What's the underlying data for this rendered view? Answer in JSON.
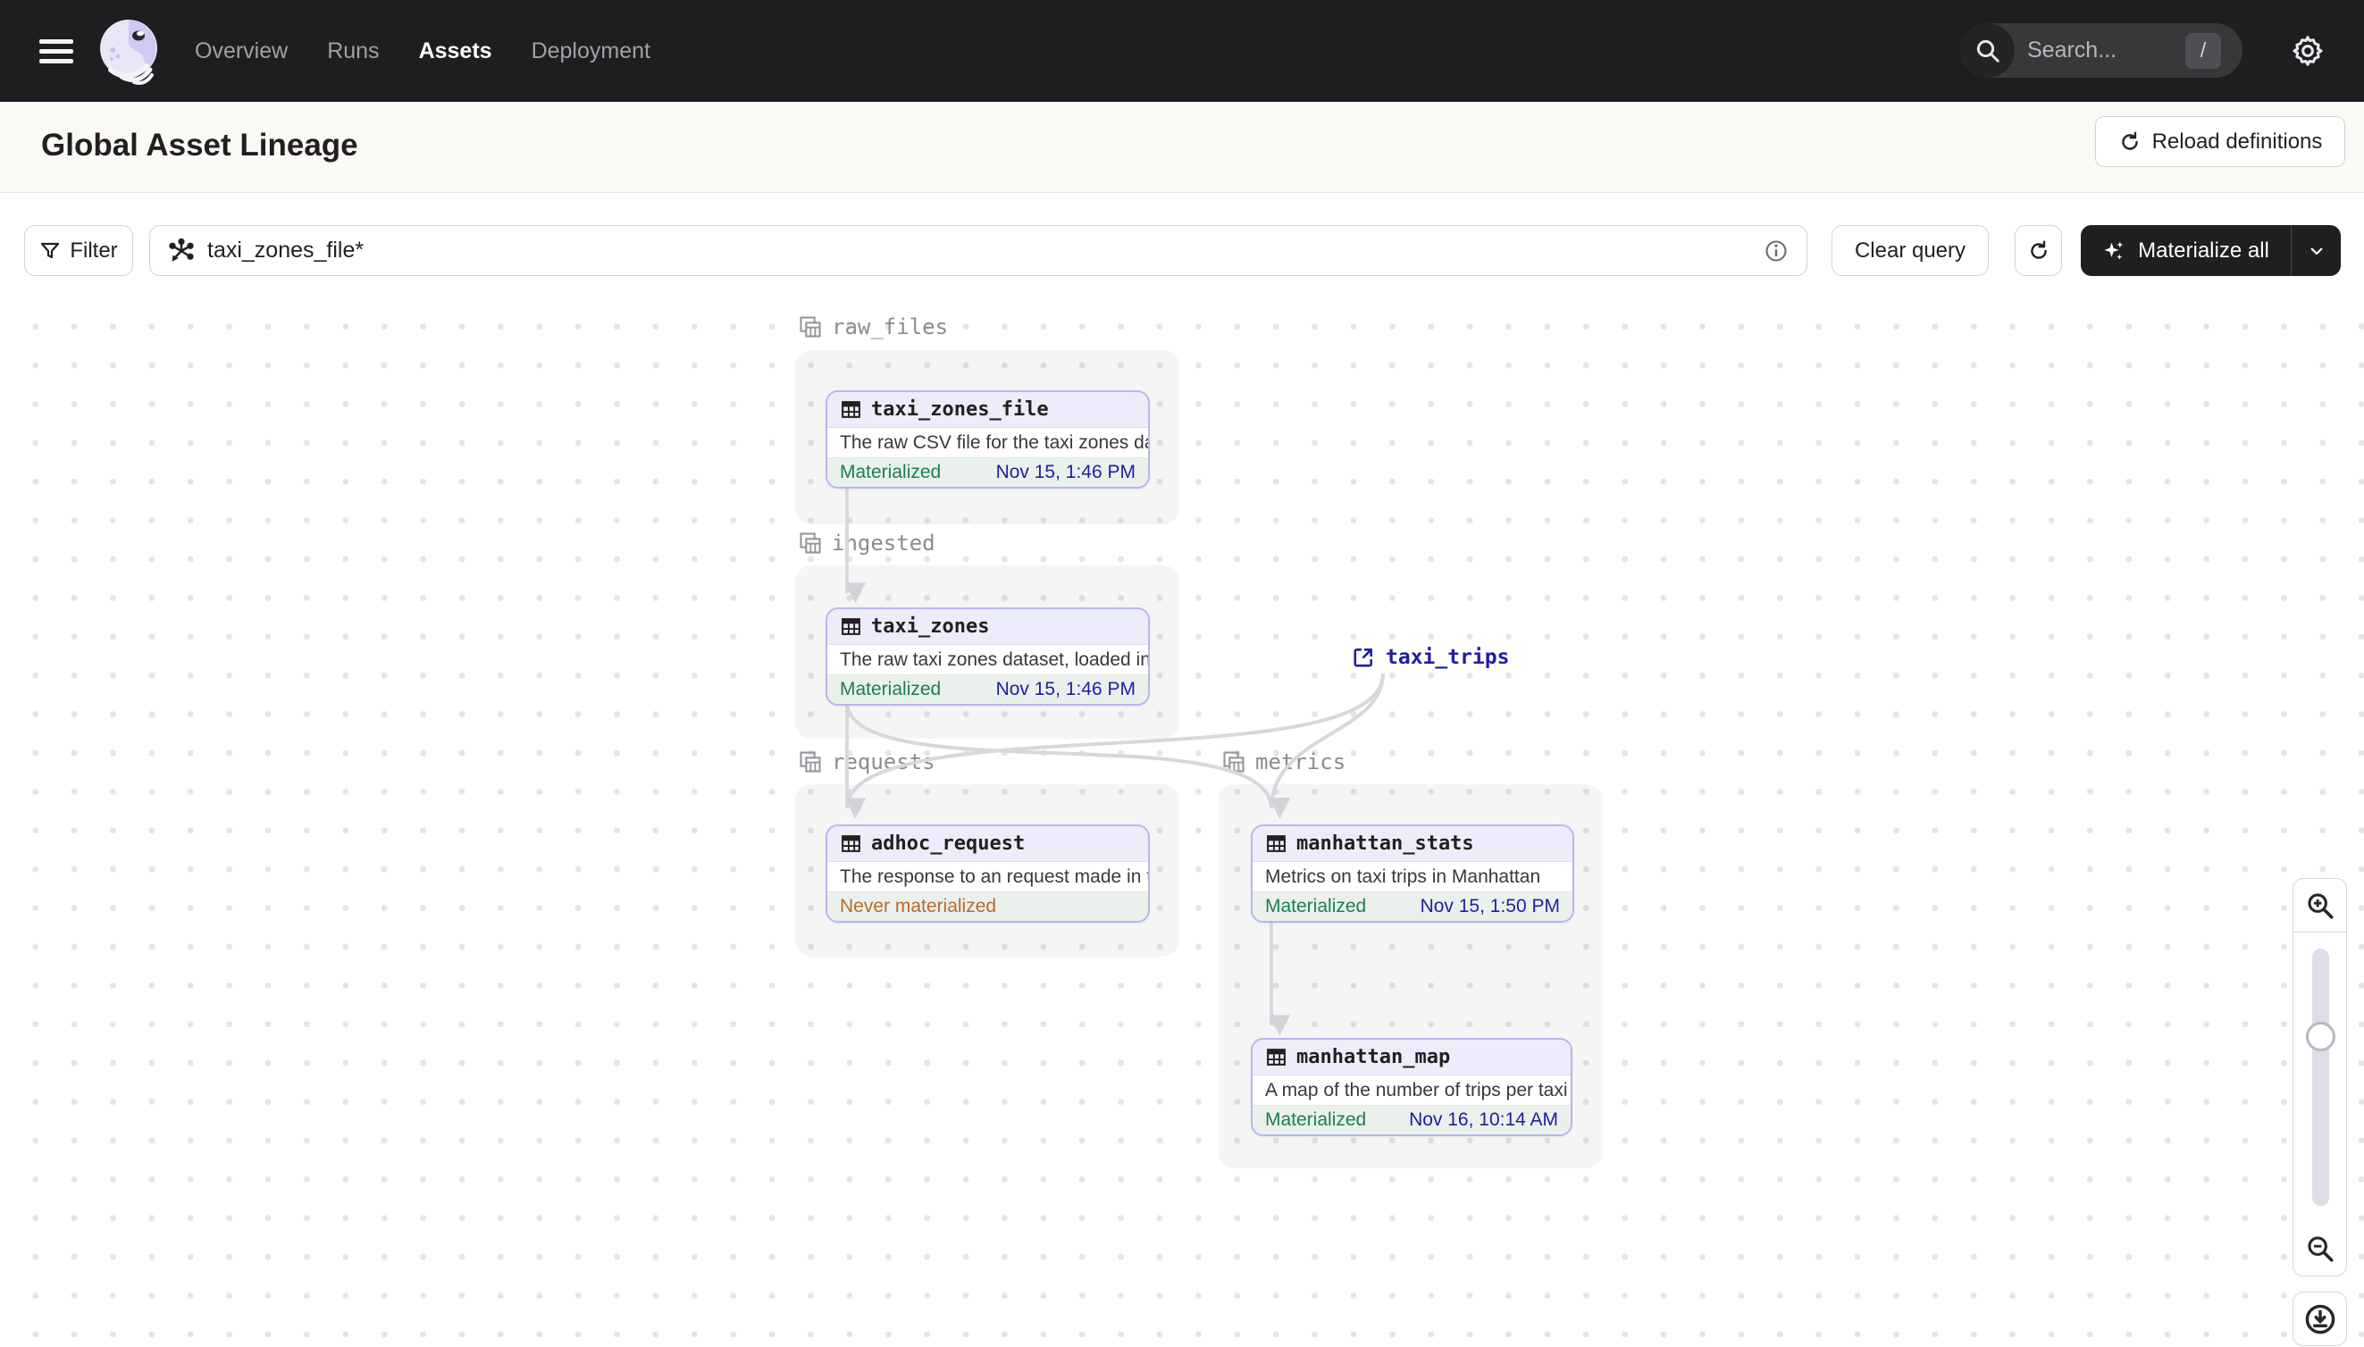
{
  "navbar": {
    "links": [
      {
        "label": "Overview",
        "active": false
      },
      {
        "label": "Runs",
        "active": false
      },
      {
        "label": "Assets",
        "active": true
      },
      {
        "label": "Deployment",
        "active": false
      }
    ],
    "search_placeholder": "Search...",
    "search_shortcut": "/"
  },
  "header": {
    "title": "Global Asset Lineage",
    "reload_label": "Reload definitions"
  },
  "toolbar": {
    "filter_label": "Filter",
    "query_value": "taxi_zones_file*",
    "clear_query_label": "Clear query",
    "materialize_label": "Materialize all"
  },
  "graph": {
    "groups": [
      {
        "name": "raw_files"
      },
      {
        "name": "ingested"
      },
      {
        "name": "requests"
      },
      {
        "name": "metrics"
      }
    ],
    "nodes": [
      {
        "name": "taxi_zones_file",
        "description": "The raw CSV file for the taxi zones dat...",
        "status": "Materialized",
        "timestamp": "Nov 15, 1:46 PM",
        "group": "raw_files"
      },
      {
        "name": "taxi_zones",
        "description": "The raw taxi zones dataset, loaded int...",
        "status": "Materialized",
        "timestamp": "Nov 15, 1:46 PM",
        "group": "ingested"
      },
      {
        "name": "adhoc_request",
        "description": "The response to an request made in th...",
        "status": "Never materialized",
        "timestamp": "",
        "group": "requests"
      },
      {
        "name": "manhattan_stats",
        "description": "Metrics on taxi trips in Manhattan",
        "status": "Materialized",
        "timestamp": "Nov 15, 1:50 PM",
        "group": "metrics"
      },
      {
        "name": "manhattan_map",
        "description": "A map of the number of trips per taxi z...",
        "status": "Materialized",
        "timestamp": "Nov 16, 10:14 AM",
        "group": "metrics"
      }
    ],
    "external_asset": {
      "name": "taxi_trips"
    },
    "edges": [
      "taxi_zones_file->taxi_zones",
      "taxi_zones->adhoc_request",
      "taxi_zones->manhattan_stats",
      "taxi_trips->adhoc_request",
      "taxi_trips->manhattan_stats",
      "manhattan_stats->manhattan_map"
    ]
  },
  "colors": {
    "navbar_bg": "#201d20",
    "accent_purple": "#b9b5ee",
    "node_header_bg": "#edecfb",
    "materialized_green": "#1e7e4f",
    "never_materialized_orange": "#bc6828",
    "timestamp_navy": "#1f1e9e",
    "edge_gray": "#d8d6dc",
    "group_label_gray": "#8d8a90"
  }
}
